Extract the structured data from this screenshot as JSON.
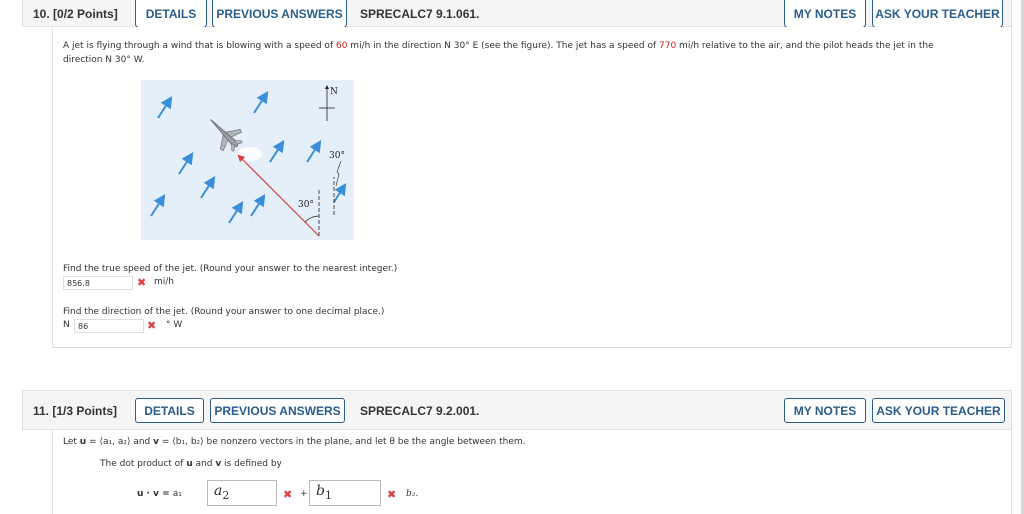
{
  "buttons": {
    "details": "DETAILS",
    "previous_answers": "PREVIOUS ANSWERS",
    "my_notes": "MY NOTES",
    "ask_teacher": "ASK YOUR TEACHER"
  },
  "q10": {
    "number": "10.",
    "points": "[0/2 Points]",
    "code": "SPRECALC7 9.1.061.",
    "prompt_1a": "A jet is flying through a wind that is blowing with a speed of ",
    "wind_speed": "60",
    "prompt_1b": " mi/h in the direction N 30° E (see the figure). The jet has a speed of ",
    "jet_speed": "770",
    "prompt_1c": " mi/h relative to the air, and the pilot heads the jet in the",
    "prompt_2": "direction N 30° W.",
    "figure": {
      "north_label": "N",
      "angle_label_1": "30°",
      "angle_label_2": "30°"
    },
    "part1": {
      "question": "Find the true speed of the jet. (Round your answer to the nearest integer.)",
      "answer": "856.8",
      "status": "incorrect",
      "unit": "mi/h"
    },
    "part2": {
      "question": "Find the direction of the jet. (Round your answer to one decimal place.)",
      "prefix": "N",
      "answer": "86",
      "status": "incorrect",
      "unit": "° W"
    }
  },
  "q11": {
    "number": "11.",
    "points": "[1/3 Points]",
    "code": "SPRECALC7 9.2.001.",
    "line1": {
      "let": "Let ",
      "u": "u",
      "eq1": " = ⟨a₁, a₂⟩ and ",
      "v": "v",
      "eq2": " = ⟨b₁, b₂⟩  be nonzero vectors in the plane, and let θ be the angle between them."
    },
    "line2": {
      "a": "The dot product of ",
      "u": "u",
      "b": " and ",
      "v": "v",
      "c": " is defined by"
    },
    "formula": {
      "lhs": "u · v = ",
      "a1": "a₁",
      "box1_main": "a",
      "box1_sub": "2",
      "box1_status": "incorrect",
      "plus": "+",
      "box2_main": "b",
      "box2_sub": "1",
      "box2_status": "incorrect",
      "tail": "b₂."
    }
  },
  "icons": {
    "incorrect": "✖"
  },
  "colors": {
    "accent": "#2a5d8c",
    "highlight_number": "#cc2020",
    "incorrect": "#d94040",
    "figure_bg": "#e4effa",
    "wind_arrow": "#3a8fd8",
    "heading_arrow": "#d94040"
  }
}
